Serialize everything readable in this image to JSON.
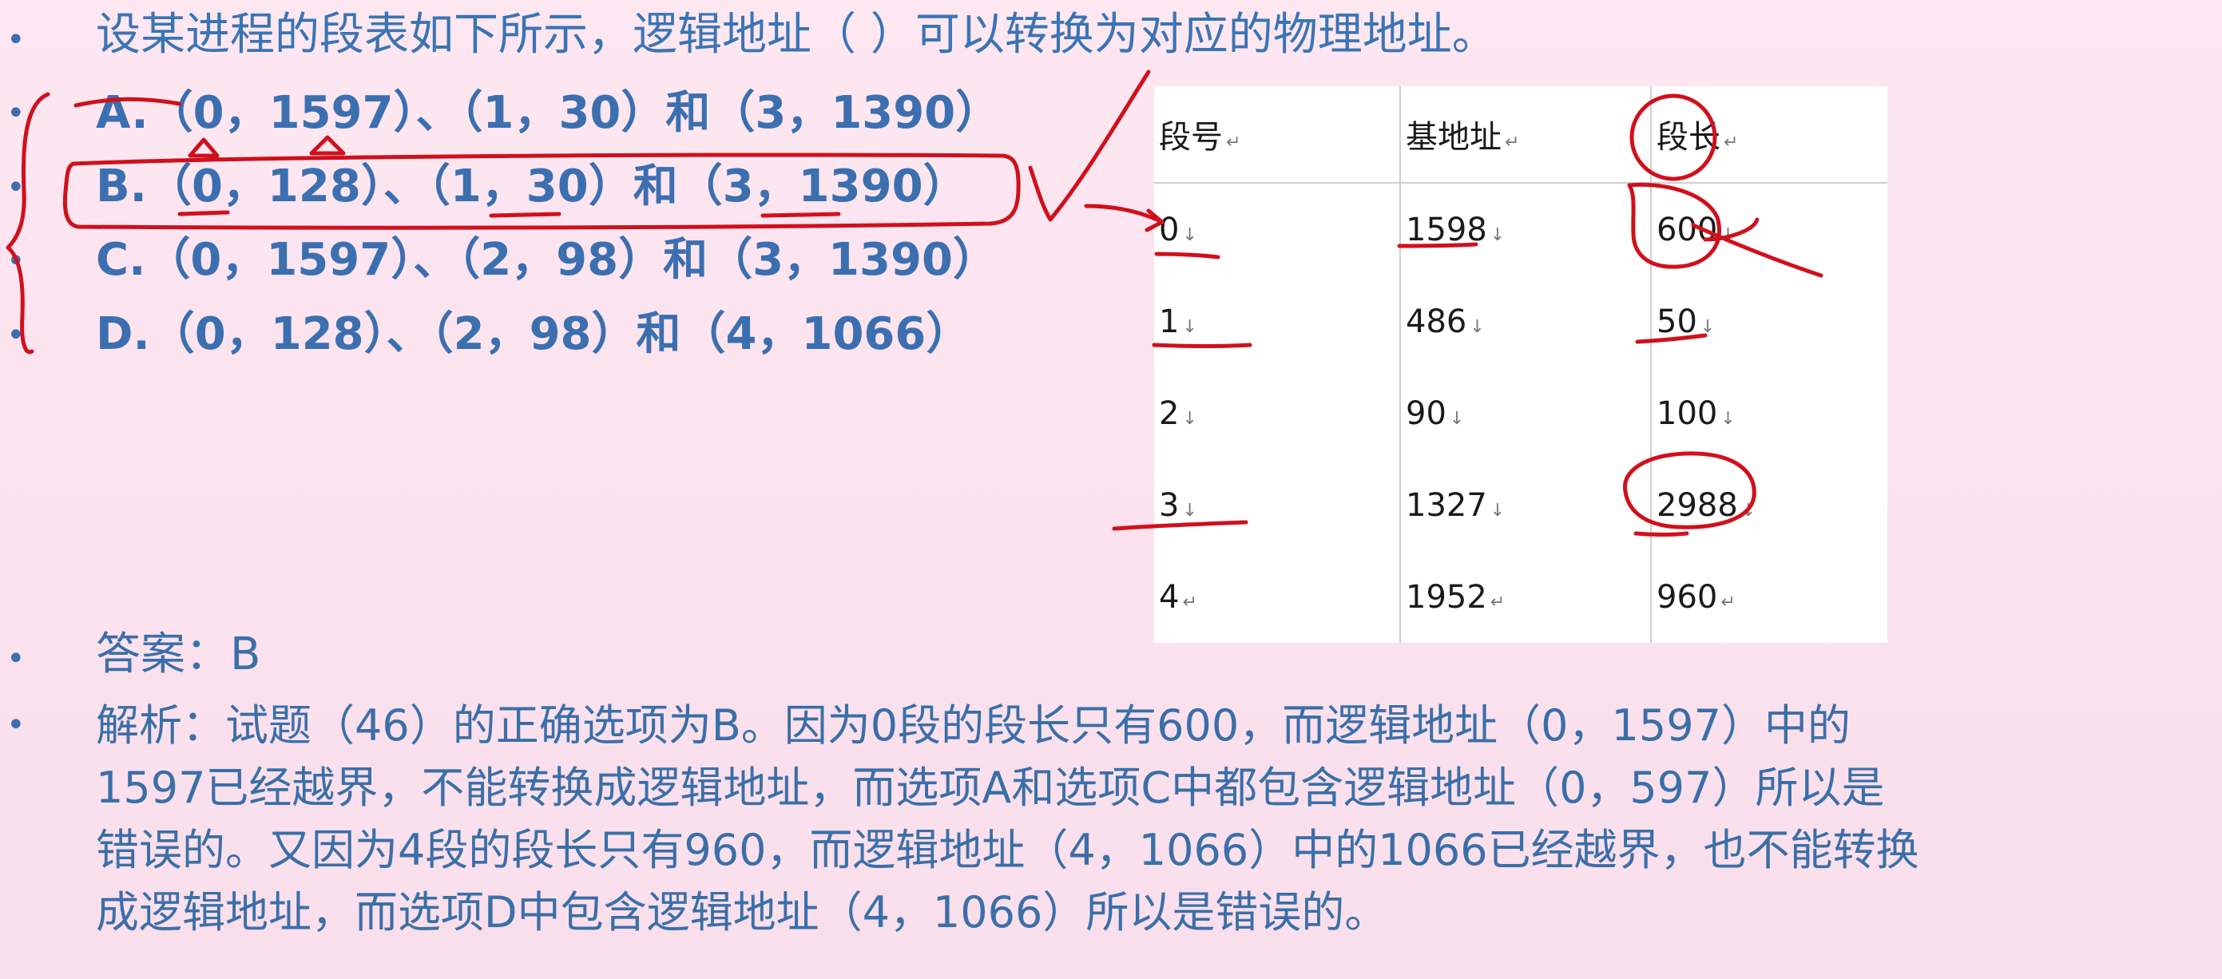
{
  "question": "设某进程的段表如下所示，逻辑地址（    ）可以转换为对应的物理地址。",
  "options": [
    "A.（0，1597）、（1，30）和（3，1390）",
    "B.（0，128）、（1，30）和（3，1390）",
    "C.（0，1597）、（2，98）和（3，1390）",
    "D.（0，128）、（2，98）和（4，1066）"
  ],
  "answer": "答案：B",
  "analysis": [
    "解析：试题（46）的正确选项为B。因为0段的段长只有600，而逻辑地址（0，1597）中的",
    "1597已经越界，不能转换成逻辑地址，而选项A和选项C中都包含逻辑地址（0，597）所以是",
    "错误的。又因为4段的段长只有960，而逻辑地址（4，1066）中的1066已经越界，也不能转换",
    "成逻辑地址，而选项D中包含逻辑地址（4，1066）所以是错误的。"
  ],
  "table": {
    "headers": [
      "段号",
      "基地址",
      "段长"
    ],
    "rows": [
      [
        "0",
        "1598",
        "600"
      ],
      [
        "1",
        "486",
        "50"
      ],
      [
        "2",
        "90",
        "100"
      ],
      [
        "3",
        "1327",
        "2988"
      ],
      [
        "4",
        "1952",
        "960"
      ]
    ]
  },
  "colors": {
    "background": "#fbe3ef",
    "text": "#3b6fb0",
    "annotation": "#d0101c"
  }
}
